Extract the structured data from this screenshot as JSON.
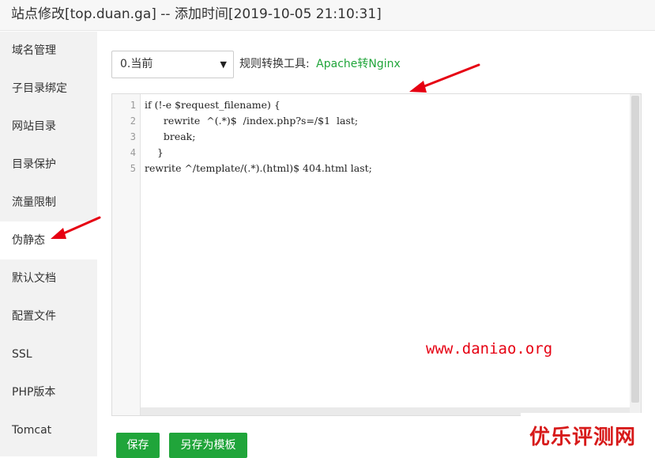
{
  "title": "站点修改[top.duan.ga] -- 添加时间[2019-10-05 21:10:31]",
  "sidebar": {
    "items": [
      {
        "label": "域名管理"
      },
      {
        "label": "子目录绑定"
      },
      {
        "label": "网站目录"
      },
      {
        "label": "目录保护"
      },
      {
        "label": "流量限制"
      },
      {
        "label": "伪静态",
        "active": true
      },
      {
        "label": "默认文档"
      },
      {
        "label": "配置文件"
      },
      {
        "label": "SSL"
      },
      {
        "label": "PHP版本"
      },
      {
        "label": "Tomcat"
      }
    ]
  },
  "rewrite": {
    "select_value": "0.当前",
    "tool_label": "规则转换工具:",
    "tool_link": "Apache转Nginx"
  },
  "editor": {
    "line_numbers": [
      "1",
      "2",
      "3",
      "4",
      "5"
    ],
    "lines": [
      "if (!-e $request_filename) {",
      "      rewrite  ^(.*)$  /index.php?s=/$1  last;",
      "      break;",
      "    }",
      "rewrite ^/template/(.*).(html)$ 404.html last;"
    ]
  },
  "buttons": {
    "save": "保存",
    "save_as_template": "另存为模板"
  },
  "watermarks": {
    "url": "www.daniao.org",
    "brand": "优乐评测网"
  },
  "colors": {
    "accent": "#20a53a",
    "annotation_red": "#e60012"
  },
  "icons": {
    "select_arrow": "caret-down-icon",
    "annotation": "red-arrow-icon"
  }
}
